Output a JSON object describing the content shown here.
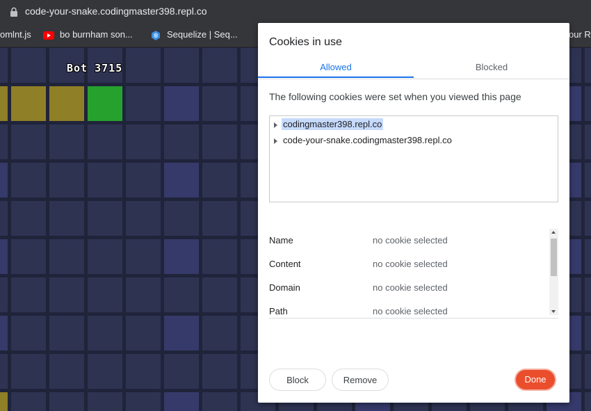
{
  "browser": {
    "url": "code-your-snake.codingmaster398.repl.co",
    "bookmarks": [
      {
        "label": "omlnt.js",
        "icon": "none"
      },
      {
        "label": "bo burnham son...",
        "icon": "youtube-icon"
      },
      {
        "label": "Sequelize | Seq...",
        "icon": "sequelize-icon"
      },
      {
        "label": "our R",
        "icon": "none"
      }
    ]
  },
  "game": {
    "bot_label": "Bot 3715",
    "colors": {
      "empty": "#2e3352",
      "empty_alt": "#363a6a",
      "snake": "#8f7f27",
      "head": "#26a12e"
    }
  },
  "dialog": {
    "title": "Cookies in use",
    "tabs": [
      {
        "label": "Allowed",
        "active": true
      },
      {
        "label": "Blocked",
        "active": false
      }
    ],
    "description": "The following cookies were set when you viewed this page",
    "sites": [
      {
        "label": "codingmaster398.repl.co",
        "selected": true
      },
      {
        "label": "code-your-snake.codingmaster398.repl.co",
        "selected": false
      }
    ],
    "details": [
      {
        "label": "Name",
        "value": "no cookie selected"
      },
      {
        "label": "Content",
        "value": "no cookie selected"
      },
      {
        "label": "Domain",
        "value": "no cookie selected"
      },
      {
        "label": "Path",
        "value": "no cookie selected"
      }
    ],
    "buttons": {
      "block": "Block",
      "remove": "Remove",
      "done": "Done"
    }
  }
}
